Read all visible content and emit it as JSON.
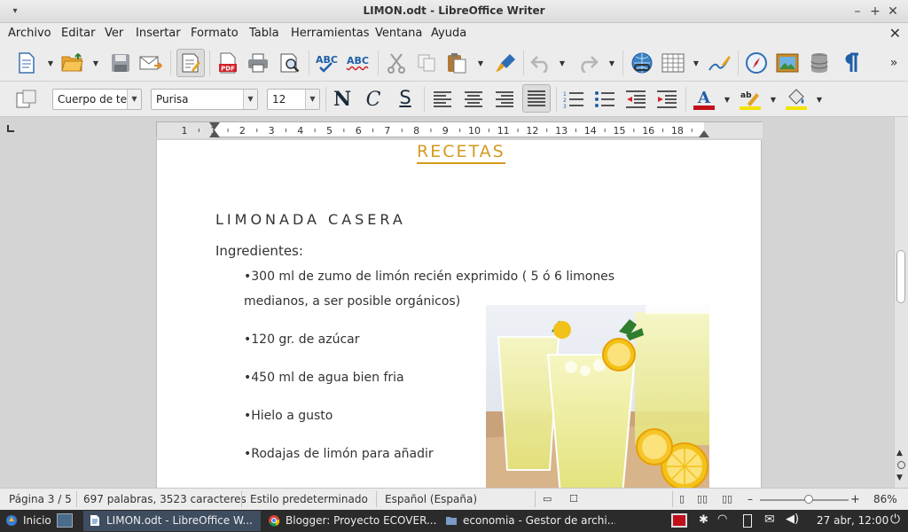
{
  "window": {
    "title": "LIMON.odt - LibreOffice Writer"
  },
  "menu": [
    "Archivo",
    "Editar",
    "Ver",
    "Insertar",
    "Formato",
    "Tabla",
    "Herramientas",
    "Ventana",
    "Ayuda"
  ],
  "format": {
    "style": "Cuerpo de te:",
    "font": "Purisa",
    "size": "12",
    "bold": "N",
    "italic": "C",
    "shadow": "S"
  },
  "ruler": {
    "ticks": [
      "1",
      "1",
      "2",
      "3",
      "4",
      "5",
      "6",
      "7",
      "8",
      "9",
      "10",
      "11",
      "12",
      "13",
      "14",
      "15",
      "16",
      "18"
    ]
  },
  "document": {
    "heading": "RECETAS",
    "recipe_title": "LIMONADA CASERA",
    "ingredients_label": "Ingredientes:",
    "items": [
      "•300 ml de zumo de limón recién exprimido ( 5 ó 6 limones",
      "medianos, a ser posible orgánicos)",
      "•120 gr. de azúcar",
      "•450 ml de agua bien fria",
      "•Hielo a gusto",
      "•Rodajas de limón para añadir"
    ]
  },
  "status": {
    "page": "Página 3 / 5",
    "words": "697 palabras, 3523 caracteres",
    "style": "Estilo predeterminado",
    "language": "Español (España)",
    "zoom": "86%",
    "zoom_level": 0.55
  },
  "taskbar": {
    "start": "Inicio",
    "tasks": [
      "LIMON.odt - LibreOffice W...",
      "Blogger: Proyecto ECOVER...",
      "economia - Gestor de archi..."
    ],
    "clock": "27 abr, 12:00"
  },
  "colors": {
    "heading": "#d49a1e",
    "accent_blue": "#2f6db5",
    "font_red": "#c0101a",
    "highlight_yellow": "#f2e400"
  }
}
